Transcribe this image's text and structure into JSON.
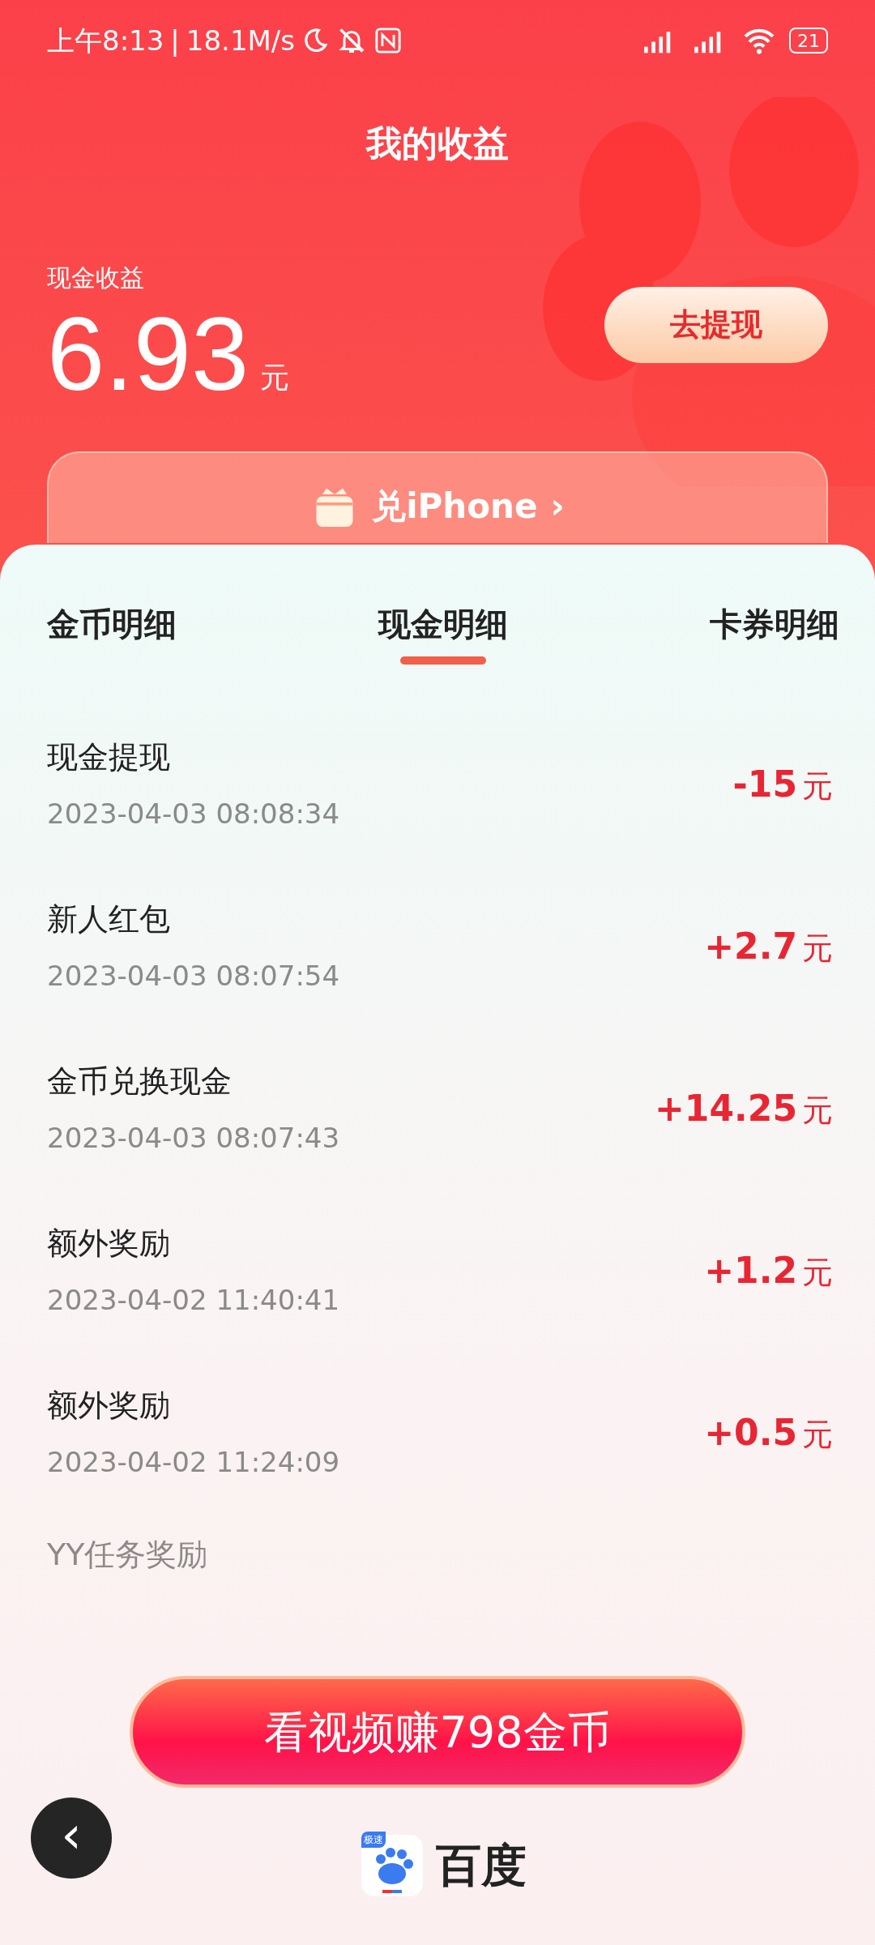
{
  "status_bar": {
    "time": "上午8:13",
    "separator": "|",
    "speed": "18.1M/s",
    "battery": "21"
  },
  "header": {
    "title": "我的收益"
  },
  "earnings": {
    "label": "现金收益",
    "amount": "6.93",
    "unit": "元",
    "withdraw_button": "去提现"
  },
  "promo": {
    "label": "兑iPhone",
    "chevron": "›"
  },
  "tabs": [
    {
      "label": "金币明细",
      "selected": false
    },
    {
      "label": "现金明细",
      "selected": true
    },
    {
      "label": "卡券明细",
      "selected": false
    }
  ],
  "records": [
    {
      "title": "现金提现",
      "time": "2023-04-03 08:08:34",
      "amount": "-15",
      "unit": "元",
      "faded": false
    },
    {
      "title": "新人红包",
      "time": "2023-04-03 08:07:54",
      "amount": "+2.7",
      "unit": "元",
      "faded": false
    },
    {
      "title": "金币兑换现金",
      "time": "2023-04-03 08:07:43",
      "amount": "+14.25",
      "unit": "元",
      "faded": false
    },
    {
      "title": "额外奖励",
      "time": "2023-04-02 11:40:41",
      "amount": "+1.2",
      "unit": "元",
      "faded": false
    },
    {
      "title": "额外奖励",
      "time": "2023-04-02 11:24:09",
      "amount": "+0.5",
      "unit": "元",
      "faded": false
    },
    {
      "title": "YY任务奖励",
      "faded": true
    }
  ],
  "cta_button": "看视频赚798金币",
  "back_button": "‹",
  "brand": {
    "name": "百度",
    "badge": "极速"
  }
}
